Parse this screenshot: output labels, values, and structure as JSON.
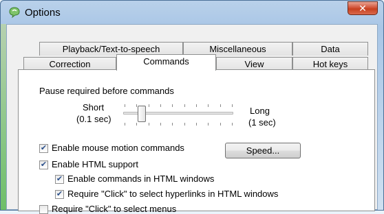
{
  "window": {
    "title": "Options",
    "close_glyph": "✕"
  },
  "tabs_row1": [
    {
      "label": "Playback/Text-to-speech"
    },
    {
      "label": "Miscellaneous"
    },
    {
      "label": "Data"
    }
  ],
  "tabs_row2": [
    {
      "label": "Correction"
    },
    {
      "label": "Commands",
      "selected": true
    },
    {
      "label": "View"
    },
    {
      "label": "Hot keys"
    }
  ],
  "commands": {
    "pause_label": "Pause required before commands",
    "short_label": "Short",
    "short_value": "(0.1 sec)",
    "long_label": "Long",
    "long_value": "(1 sec)",
    "slider_position": 0.16,
    "speed_button": "Speed...",
    "checkboxes": [
      {
        "label": "Enable mouse motion commands",
        "checked": true
      },
      {
        "label": "Enable HTML support",
        "checked": true
      },
      {
        "label": "Enable commands in HTML windows",
        "checked": true
      },
      {
        "label": "Require \"Click\" to select hyperlinks in HTML windows",
        "checked": true
      },
      {
        "label": "Require \"Click\" to select menus",
        "checked": false
      }
    ]
  },
  "colors": {
    "accent": "#2a4f8a",
    "close": "#c7401f"
  },
  "icons": {
    "app": "speech-bubble-icon",
    "check": "checkmark-icon"
  }
}
